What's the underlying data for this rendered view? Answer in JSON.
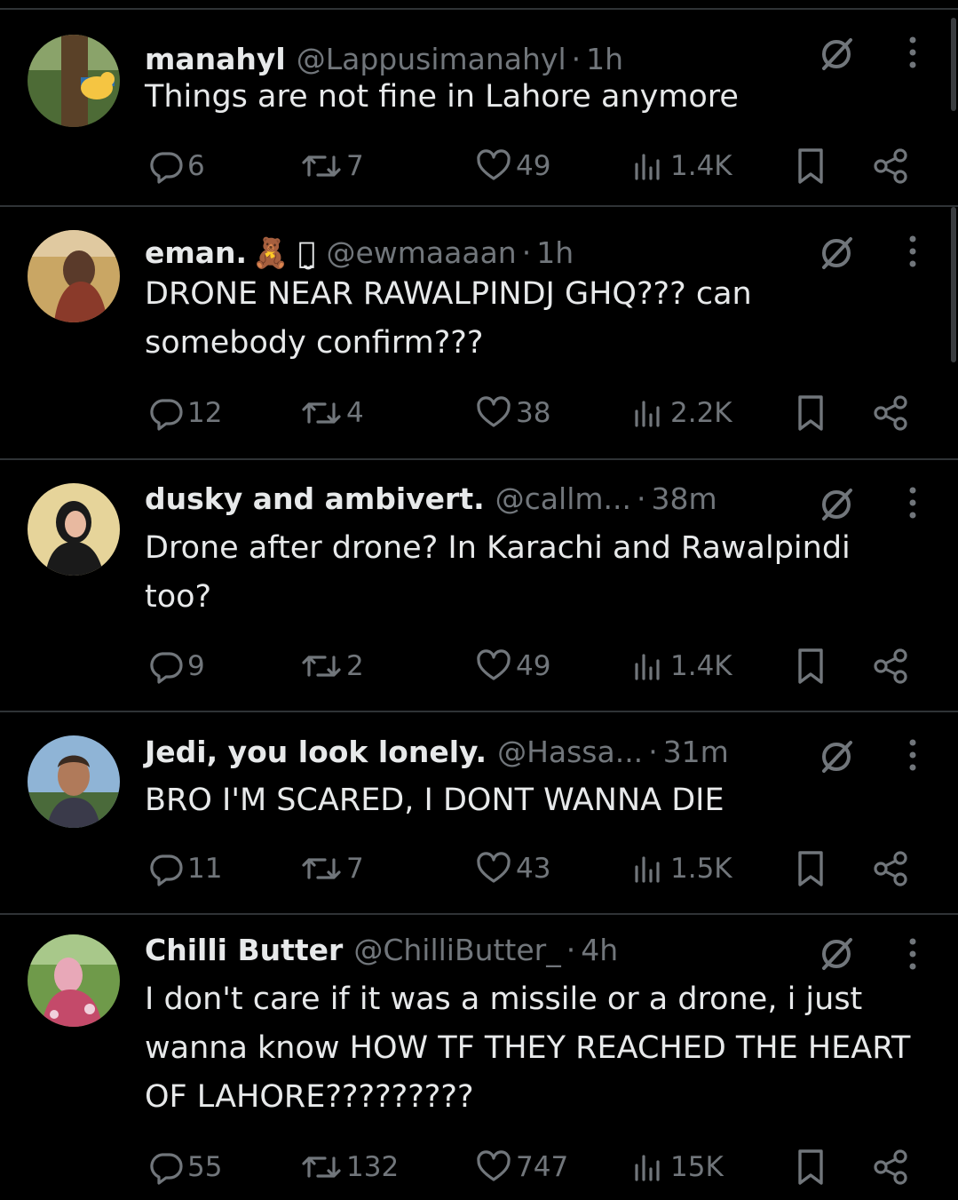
{
  "tweets": [
    {
      "name": "manahyl",
      "badge": "",
      "handle": "@Lappusimanahyl",
      "time": "1h",
      "text": "Things are not fine in Lahore anymore",
      "replies": "6",
      "reposts": "7",
      "likes": "49",
      "views": "1.4K",
      "avatar_colors": [
        "#3b5a2a",
        "#6b4e2c",
        "#f5c542"
      ]
    },
    {
      "name": "eman.",
      "badge": "🧸 ꪔ̤̮",
      "handle": "@ewmaaaan",
      "time": "1h",
      "text": "DRONE NEAR RAWALPINDJ GHQ??? can somebody confirm???",
      "replies": "12",
      "reposts": "4",
      "likes": "38",
      "views": "2.2K",
      "avatar_colors": [
        "#c9a664",
        "#8a3a2a",
        "#e0c9a0"
      ]
    },
    {
      "name": "dusky and ambivert.",
      "badge": "",
      "handle": "@callm...",
      "time": "38m",
      "text": "Drone after drone? In Karachi and Rawalpindi too?",
      "replies": "9",
      "reposts": "2",
      "likes": "49",
      "views": "1.4K",
      "avatar_colors": [
        "#e6d49a",
        "#1a1a1a",
        "#e8b9a0"
      ]
    },
    {
      "name": "Jedi, you look lonely.",
      "badge": "",
      "handle": "@Hassa...",
      "time": "31m",
      "text": "BRO I'M SCARED, I DONT WANNA DIE",
      "replies": "11",
      "reposts": "7",
      "likes": "43",
      "views": "1.5K",
      "avatar_colors": [
        "#8fb4d6",
        "#3a2a20",
        "#b07a5a"
      ]
    },
    {
      "name": "Chilli Butter",
      "badge": "",
      "handle": "@ChilliButter_",
      "time": "4h",
      "text": "I don't care if it was a missile or a drone, i just wanna know HOW TF THEY REACHED THE HEART OF LAHORE?????????",
      "replies": "55",
      "reposts": "132",
      "likes": "747",
      "views": "15K",
      "avatar_colors": [
        "#6f9a4a",
        "#e8a8b8",
        "#c44a6a"
      ]
    }
  ],
  "icons": {
    "reply": "reply-icon",
    "repost": "repost-icon",
    "like": "heart-icon",
    "views": "views-icon",
    "bookmark": "bookmark-icon",
    "share": "share-icon",
    "grok": "grok-icon",
    "more": "more-icon"
  },
  "colors": {
    "background": "#000000",
    "text": "#e7e9ea",
    "muted": "#71767b",
    "divider": "#2f3336"
  }
}
